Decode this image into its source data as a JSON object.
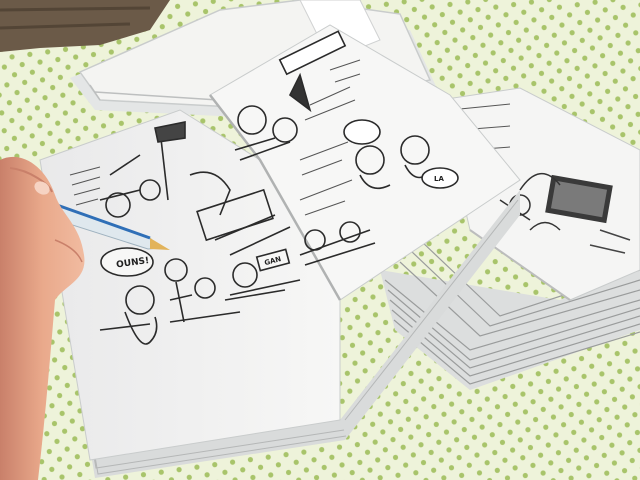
{
  "comic": {
    "balloon_1": "OUNS!",
    "balloon_2": "LA",
    "balloon_3": "GAN"
  },
  "colors": {
    "tablecloth": "#eef3da",
    "polka_dot": "#a8c46a",
    "paper": "#f4f4f2",
    "paper_shadow": "#c9cccc",
    "ink": "#2b2b2b",
    "pen_body": "#dfe8ee",
    "pen_stripe": "#2f6fb7",
    "pen_tip": "#e2b35a",
    "skin": "#e9a98b",
    "skin_shadow": "#c9806a",
    "fabric": "#6b5a48"
  },
  "icons": {
    "pen": "ballpoint-pen-icon",
    "hand": "hand-icon"
  }
}
